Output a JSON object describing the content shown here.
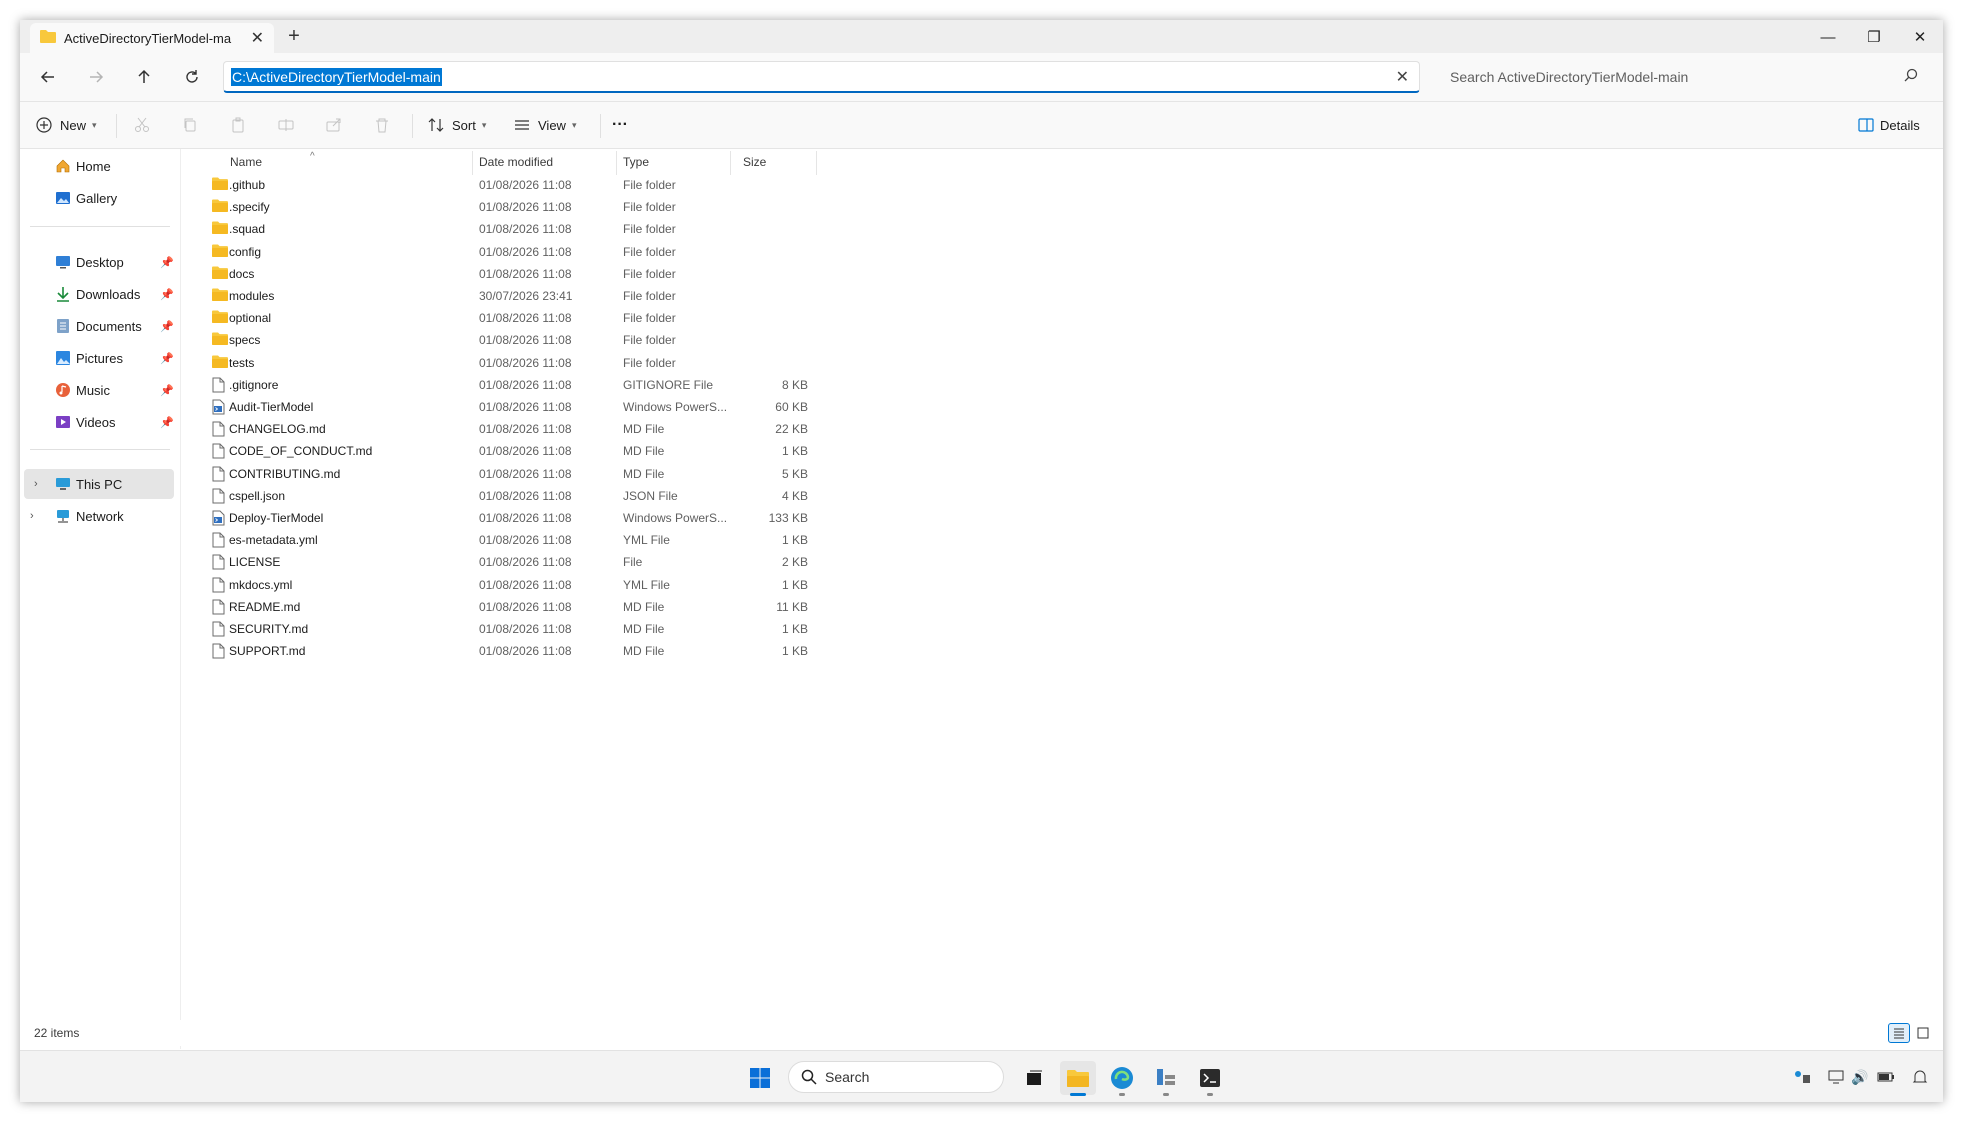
{
  "window": {
    "tab_title": "ActiveDirectoryTierModel-ma",
    "new_tab": "+",
    "minimize": "—",
    "restore": "❐",
    "close": "✕"
  },
  "address": {
    "path": "C:\\ActiveDirectoryTierModel-main",
    "search_placeholder": "Search ActiveDirectoryTierModel-main"
  },
  "toolbar": {
    "new_label": "New",
    "sort_label": "Sort",
    "view_label": "View",
    "more_label": "···",
    "details_label": "Details"
  },
  "sidebar": {
    "quick": [
      {
        "label": "Home",
        "icon": "home-icon"
      },
      {
        "label": "Gallery",
        "icon": "gallery-icon"
      }
    ],
    "pinned": [
      {
        "label": "Desktop",
        "icon": "desktop-icon"
      },
      {
        "label": "Downloads",
        "icon": "downloads-icon"
      },
      {
        "label": "Documents",
        "icon": "documents-icon"
      },
      {
        "label": "Pictures",
        "icon": "pictures-icon"
      },
      {
        "label": "Music",
        "icon": "music-icon"
      },
      {
        "label": "Videos",
        "icon": "videos-icon"
      }
    ],
    "tree": [
      {
        "label": "This PC",
        "icon": "computer-icon",
        "selected": true
      },
      {
        "label": "Network",
        "icon": "network-icon"
      }
    ]
  },
  "columns": {
    "name": "Name",
    "date": "Date modified",
    "type": "Type",
    "size": "Size"
  },
  "files": [
    {
      "name": ".github",
      "date": "01/08/2026 11:08",
      "type": "File folder",
      "size": "",
      "kind": "folder"
    },
    {
      "name": ".specify",
      "date": "01/08/2026 11:08",
      "type": "File folder",
      "size": "",
      "kind": "folder"
    },
    {
      "name": ".squad",
      "date": "01/08/2026 11:08",
      "type": "File folder",
      "size": "",
      "kind": "folder"
    },
    {
      "name": "config",
      "date": "01/08/2026 11:08",
      "type": "File folder",
      "size": "",
      "kind": "folder"
    },
    {
      "name": "docs",
      "date": "01/08/2026 11:08",
      "type": "File folder",
      "size": "",
      "kind": "folder"
    },
    {
      "name": "modules",
      "date": "30/07/2026 23:41",
      "type": "File folder",
      "size": "",
      "kind": "folder"
    },
    {
      "name": "optional",
      "date": "01/08/2026 11:08",
      "type": "File folder",
      "size": "",
      "kind": "folder"
    },
    {
      "name": "specs",
      "date": "01/08/2026 11:08",
      "type": "File folder",
      "size": "",
      "kind": "folder"
    },
    {
      "name": "tests",
      "date": "01/08/2026 11:08",
      "type": "File folder",
      "size": "",
      "kind": "folder"
    },
    {
      "name": ".gitignore",
      "date": "01/08/2026 11:08",
      "type": "GITIGNORE File",
      "size": "8 KB",
      "kind": "file"
    },
    {
      "name": "Audit-TierModel",
      "date": "01/08/2026 11:08",
      "type": "Windows PowerS...",
      "size": "60 KB",
      "kind": "script"
    },
    {
      "name": "CHANGELOG.md",
      "date": "01/08/2026 11:08",
      "type": "MD File",
      "size": "22 KB",
      "kind": "file"
    },
    {
      "name": "CODE_OF_CONDUCT.md",
      "date": "01/08/2026 11:08",
      "type": "MD File",
      "size": "1 KB",
      "kind": "file"
    },
    {
      "name": "CONTRIBUTING.md",
      "date": "01/08/2026 11:08",
      "type": "MD File",
      "size": "5 KB",
      "kind": "file"
    },
    {
      "name": "cspell.json",
      "date": "01/08/2026 11:08",
      "type": "JSON File",
      "size": "4 KB",
      "kind": "file"
    },
    {
      "name": "Deploy-TierModel",
      "date": "01/08/2026 11:08",
      "type": "Windows PowerS...",
      "size": "133 KB",
      "kind": "script"
    },
    {
      "name": "es-metadata.yml",
      "date": "01/08/2026 11:08",
      "type": "YML File",
      "size": "1 KB",
      "kind": "file"
    },
    {
      "name": "LICENSE",
      "date": "01/08/2026 11:08",
      "type": "File",
      "size": "2 KB",
      "kind": "file"
    },
    {
      "name": "mkdocs.yml",
      "date": "01/08/2026 11:08",
      "type": "YML File",
      "size": "1 KB",
      "kind": "file"
    },
    {
      "name": "README.md",
      "date": "01/08/2026 11:08",
      "type": "MD File",
      "size": "11 KB",
      "kind": "file"
    },
    {
      "name": "SECURITY.md",
      "date": "01/08/2026 11:08",
      "type": "MD File",
      "size": "1 KB",
      "kind": "file"
    },
    {
      "name": "SUPPORT.md",
      "date": "01/08/2026 11:08",
      "type": "MD File",
      "size": "1 KB",
      "kind": "file"
    }
  ],
  "status": {
    "count": "22 items"
  },
  "taskbar": {
    "search_label": "Search"
  },
  "colors": {
    "accent": "#0078d4",
    "folder": "#f8c83c",
    "selected": "#e5e5e5"
  }
}
